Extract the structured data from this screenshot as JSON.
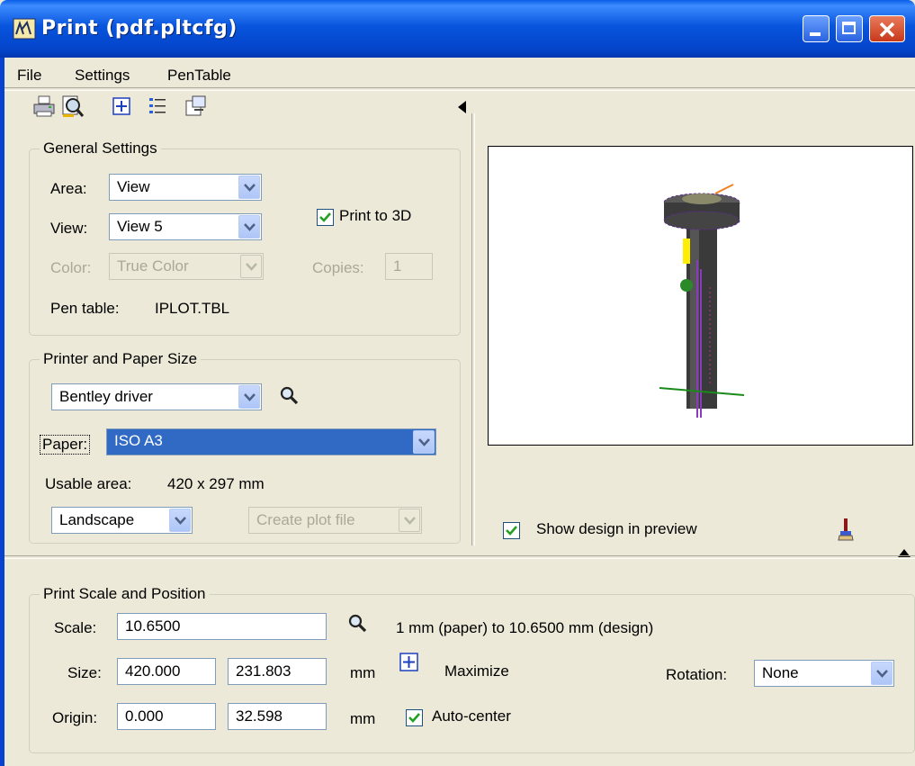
{
  "window": {
    "title": "Print  (pdf.pltcfg)"
  },
  "menu": {
    "file": "File",
    "settings": "Settings",
    "pentable": "PenTable"
  },
  "toolbar": {
    "icons": [
      "printer-icon",
      "preview-icon",
      "maximize-icon",
      "list-icon",
      "export-icon"
    ]
  },
  "general": {
    "title": "General Settings",
    "area_label": "Area:",
    "area_value": "View",
    "view_label": "View:",
    "view_value": "View 5",
    "color_label": "Color:",
    "color_value": "True Color",
    "print3d_label": "Print to 3D",
    "print3d_checked": true,
    "copies_label": "Copies:",
    "copies_value": "1",
    "pentable_label": "Pen table:",
    "pentable_value": "IPLOT.TBL"
  },
  "printer": {
    "title": "Printer and Paper Size",
    "driver_value": "Bentley driver",
    "paper_label": "Paper:",
    "paper_value": "ISO A3",
    "usable_label": "Usable area:",
    "usable_value": "420 x 297 mm",
    "orientation_value": "Landscape",
    "plotfile_value": "Create plot file"
  },
  "preview": {
    "show_design_label": "Show design in preview",
    "show_design_checked": true
  },
  "scale": {
    "title": "Print Scale and Position",
    "scale_label": "Scale:",
    "scale_value": "10.6500",
    "scale_desc": "1 mm (paper) to 10.6500 mm (design)",
    "size_label": "Size:",
    "size_w": "420.000",
    "size_h": "231.803",
    "size_unit": "mm",
    "maximize_label": "Maximize",
    "origin_label": "Origin:",
    "origin_x": "0.000",
    "origin_y": "32.598",
    "origin_unit": "mm",
    "autocenter_label": "Auto-center",
    "autocenter_checked": true,
    "rotation_label": "Rotation:",
    "rotation_value": "None"
  },
  "colors": {
    "titlebar": "#0855dd",
    "dialog_bg": "#ece9d8",
    "selection": "#316ac5",
    "checkmark": "#21a121"
  }
}
